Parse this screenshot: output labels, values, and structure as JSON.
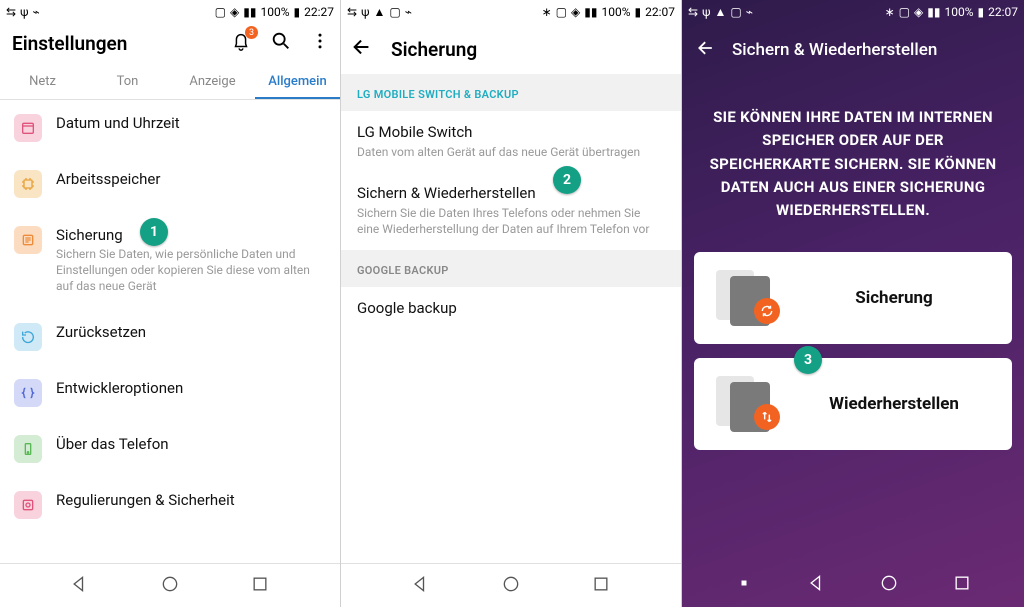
{
  "screen1": {
    "status": {
      "battery": "100%",
      "time": "22:27"
    },
    "title": "Einstellungen",
    "notification_count": "3",
    "tabs": [
      "Netz",
      "Ton",
      "Anzeige",
      "Allgemein"
    ],
    "active_tab": 3,
    "items": [
      {
        "title": "Datum und Uhrzeit",
        "sub": "",
        "color": "#e0537c"
      },
      {
        "title": "Arbeitsspeicher",
        "sub": "",
        "color": "#e8a23a"
      },
      {
        "title": "Sicherung",
        "sub": "Sichern Sie Daten, wie persönliche Daten und Einstellungen oder kopieren Sie diese vom alten auf das neue Gerät",
        "color": "#ed8b3b"
      },
      {
        "title": "Zurücksetzen",
        "sub": "",
        "color": "#3aa7d8"
      },
      {
        "title": "Entwickleroptionen",
        "sub": "",
        "color": "#4d63d6"
      },
      {
        "title": "Über das Telefon",
        "sub": "",
        "color": "#57b855"
      },
      {
        "title": "Regulierungen & Sicherheit",
        "sub": "",
        "color": "#e0537c"
      }
    ],
    "step_label": "1"
  },
  "screen2": {
    "status": {
      "battery": "100%",
      "time": "22:07"
    },
    "title": "Sicherung",
    "section1": "LG MOBILE SWITCH & BACKUP",
    "items1": [
      {
        "title": "LG Mobile Switch",
        "sub": "Daten vom alten Gerät auf das neue Gerät übertragen"
      },
      {
        "title": "Sichern & Wiederherstellen",
        "sub": "Sichern Sie die Daten Ihres Telefons oder nehmen Sie eine Wiederherstellung der Daten auf Ihrem Telefon vor"
      }
    ],
    "section2": "GOOGLE BACKUP",
    "items2": [
      {
        "title": "Google backup",
        "sub": ""
      }
    ],
    "step_label": "2"
  },
  "screen3": {
    "status": {
      "battery": "100%",
      "time": "22:07"
    },
    "title": "Sichern & Wiederherstellen",
    "intro": "SIE KÖNNEN IHRE DATEN IM INTERNEN SPEICHER ODER AUF DER SPEICHERKARTE SICHERN. SIE KÖNNEN DATEN AUCH AUS EINER SICHERUNG WIEDERHERSTELLEN.",
    "card1": "Sicherung",
    "card2": "Wiederherstellen",
    "step_label": "3"
  }
}
